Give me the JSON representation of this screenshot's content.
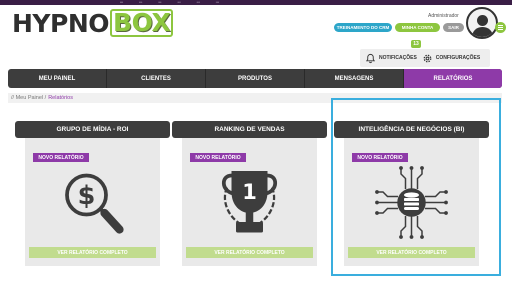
{
  "header": {
    "logo_part1": "HYPNO",
    "logo_part2": "BOX",
    "top_menu": [
      "•••",
      "•••",
      "•••",
      "•••",
      "•••",
      "•••"
    ],
    "user_name": "Administrador",
    "buttons": {
      "training": "TREINAMENTO DO CRM",
      "account": "MINHA CONTA",
      "logout": "SAIR"
    },
    "notification_count": "13",
    "notifications_label": "NOTIFICAÇÕES",
    "settings_label": "CONFIGURAÇÕES"
  },
  "nav": {
    "tabs": [
      {
        "label": "MEU PAINEL",
        "active": false
      },
      {
        "label": "CLIENTES",
        "active": false
      },
      {
        "label": "PRODUTOS",
        "active": false
      },
      {
        "label": "MENSAGENS",
        "active": false
      },
      {
        "label": "RELATÓRIOS",
        "active": true
      }
    ]
  },
  "breadcrumb": {
    "prefix": "//",
    "home": "Meu Painel",
    "separator": "/",
    "current": "Relatórios"
  },
  "cards": [
    {
      "title": "GRUPO DE MÍDIA - ROI",
      "badge": "NOVO RELATÓRIO",
      "icon": "money-search-icon",
      "button": "VER RELATÓRIO COMPLETO"
    },
    {
      "title": "RANKING DE VENDAS",
      "badge": "NOVO RELATÓRIO",
      "icon": "trophy-icon",
      "button": "VER RELATÓRIO COMPLETO",
      "trophy_number": "1"
    },
    {
      "title": "INTELIGÊNCIA DE NEGÓCIOS (BI)",
      "badge": "NOVO RELATÓRIO",
      "icon": "database-circuit-icon",
      "button": "VER RELATÓRIO COMPLETO"
    }
  ],
  "colors": {
    "purple": "#8e3aa8",
    "green": "#8dc63f",
    "blue": "#2da6c9",
    "dark": "#3d3d3d",
    "highlight": "#3aaede"
  }
}
